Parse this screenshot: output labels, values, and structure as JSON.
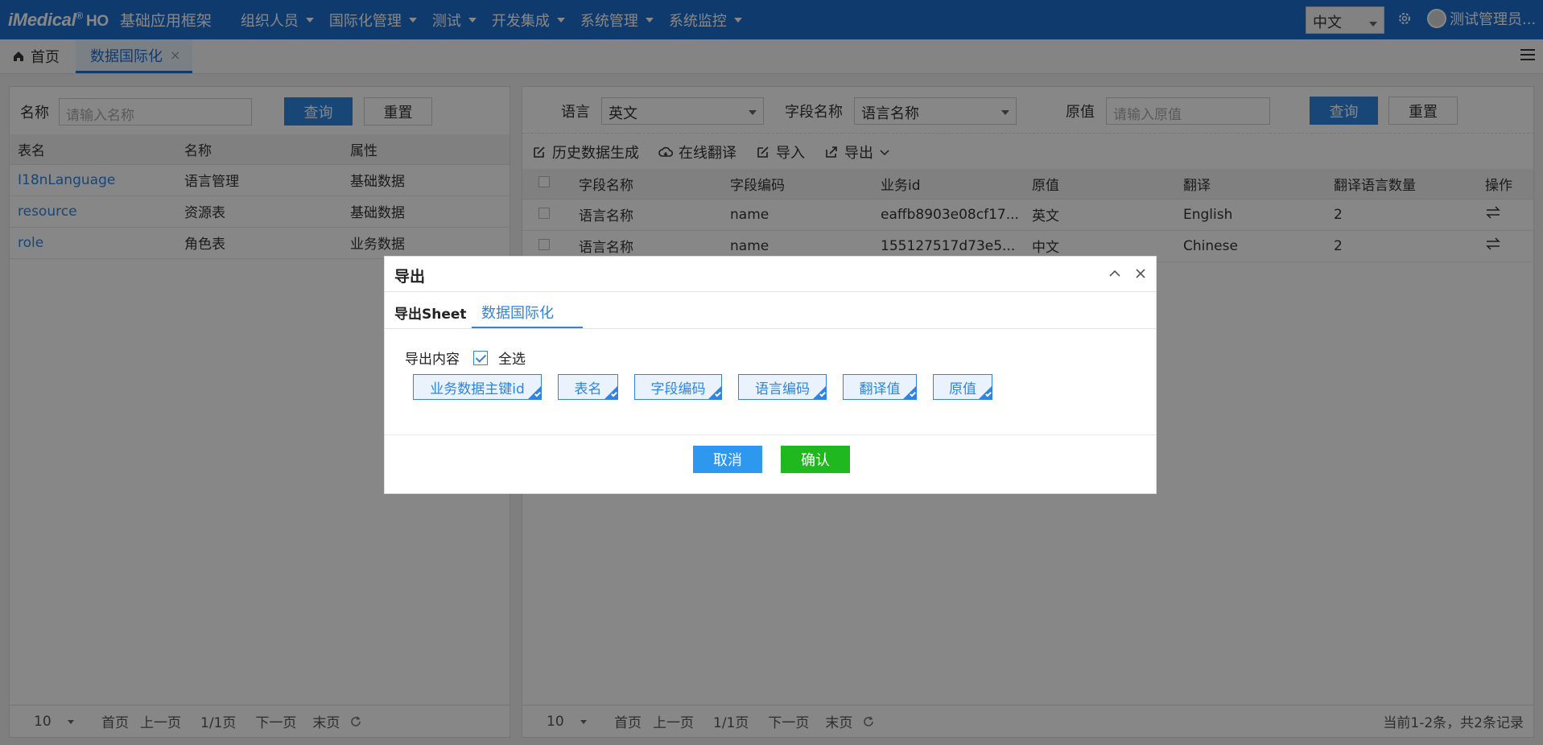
{
  "header": {
    "logo": "iMedical",
    "logo_reg": "®",
    "logo_suffix": "HO",
    "app_title": "基础应用框架",
    "nav": [
      "组织人员",
      "国际化管理",
      "测试",
      "开发集成",
      "系统管理",
      "系统监控"
    ],
    "language": "中文",
    "user_name": "测试管理员..."
  },
  "tabs": {
    "home": "首页",
    "active": "数据国际化",
    "close": "×"
  },
  "left": {
    "name_label": "名称",
    "name_placeholder": "请输入名称",
    "query": "查询",
    "reset": "重置",
    "columns": [
      "表名",
      "名称",
      "属性"
    ],
    "rows": [
      [
        "I18nLanguage",
        "语言管理",
        "基础数据"
      ],
      [
        "resource",
        "资源表",
        "基础数据"
      ],
      [
        "role",
        "角色表",
        "业务数据"
      ]
    ],
    "pager": {
      "size": "10",
      "first": "首页",
      "prev": "上一页",
      "page": "1/1页",
      "next": "下一页",
      "last": "末页"
    }
  },
  "right": {
    "lang_label": "语言",
    "lang_value": "英文",
    "field_label": "字段名称",
    "field_value": "语言名称",
    "orig_label": "原值",
    "orig_placeholder": "请输入原值",
    "query": "查询",
    "reset": "重置",
    "toolbar": [
      "历史数据生成",
      "在线翻译",
      "导入",
      "导出"
    ],
    "columns": [
      "字段名称",
      "字段编码",
      "业务id",
      "原值",
      "翻译",
      "翻译语言数量",
      "操作"
    ],
    "rows": [
      [
        "语言名称",
        "name",
        "eaffb8903e08cf17...",
        "英文",
        "English",
        "2"
      ],
      [
        "语言名称",
        "name",
        "155127517d73e5...",
        "中文",
        "Chinese",
        "2"
      ]
    ],
    "pager": {
      "size": "10",
      "first": "首页",
      "prev": "上一页",
      "page": "1/1页",
      "next": "下一页",
      "last": "末页",
      "summary": "当前1-2条，共2条记录"
    }
  },
  "modal": {
    "title": "导出",
    "sheet_label": "导出Sheet",
    "sheet_tab": "数据国际化",
    "content_label": "导出内容",
    "select_all": "全选",
    "chips": [
      "业务数据主键id",
      "表名",
      "字段编码",
      "语言编码",
      "翻译值",
      "原值"
    ],
    "cancel": "取消",
    "confirm": "确认"
  },
  "colors": {
    "primary": "#1e6fd0",
    "button": "#2e84e0",
    "confirm": "#1fb81f",
    "cancel": "#2e98ee"
  }
}
